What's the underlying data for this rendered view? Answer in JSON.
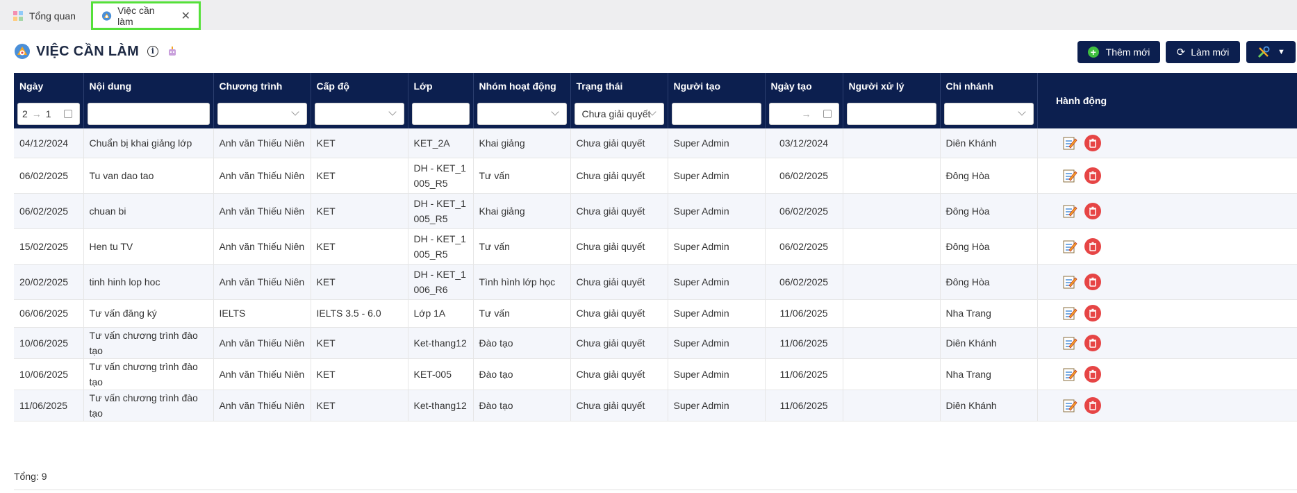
{
  "tabs": [
    {
      "label": "Tổng quan"
    },
    {
      "label": "Việc cần làm"
    }
  ],
  "page": {
    "title": "VIỆC CẦN LÀM"
  },
  "toolbar": {
    "add_label": "Thêm mới",
    "refresh_label": "Làm mới"
  },
  "columns": [
    "Ngày",
    "Nội dung",
    "Chương trình",
    "Cấp độ",
    "Lớp",
    "Nhóm hoạt động",
    "Trạng thái",
    "Người tạo",
    "Ngày tạo",
    "Người xử lý",
    "Chi nhánh",
    "Hành động"
  ],
  "filters": {
    "date_from": "2",
    "date_to": "1",
    "status": "Chưa giải quyết"
  },
  "rows": [
    {
      "date": "04/12/2024",
      "content": "Chuẩn bị khai giảng lớp",
      "program": "Anh văn Thiếu Niên",
      "level": "KET",
      "class_l1": "KET_2A",
      "class_l2": "",
      "group": "Khai giảng",
      "status": "Chưa giải quyết",
      "creator": "Super Admin",
      "created": "03/12/2024",
      "handler": "",
      "branch": "Diên Khánh"
    },
    {
      "date": "06/02/2025",
      "content": "Tu van dao tao",
      "program": "Anh văn Thiếu Niên",
      "level": "KET",
      "class_l1": "DH - KET_1",
      "class_l2": "005_R5",
      "group": "Tư vấn",
      "status": "Chưa giải quyết",
      "creator": "Super Admin",
      "created": "06/02/2025",
      "handler": "",
      "branch": "Đông Hòa"
    },
    {
      "date": "06/02/2025",
      "content": "chuan bi",
      "program": "Anh văn Thiếu Niên",
      "level": "KET",
      "class_l1": "DH - KET_1",
      "class_l2": "005_R5",
      "group": "Khai giảng",
      "status": "Chưa giải quyết",
      "creator": "Super Admin",
      "created": "06/02/2025",
      "handler": "",
      "branch": "Đông Hòa"
    },
    {
      "date": "15/02/2025",
      "content": "Hen tu TV",
      "program": "Anh văn Thiếu Niên",
      "level": "KET",
      "class_l1": "DH - KET_1",
      "class_l2": "005_R5",
      "group": "Tư vấn",
      "status": "Chưa giải quyết",
      "creator": "Super Admin",
      "created": "06/02/2025",
      "handler": "",
      "branch": "Đông Hòa"
    },
    {
      "date": "20/02/2025",
      "content": "tinh hinh lop hoc",
      "program": "Anh văn Thiếu Niên",
      "level": "KET",
      "class_l1": "DH - KET_1",
      "class_l2": "006_R6",
      "group": "Tình hình lớp học",
      "status": "Chưa giải quyết",
      "creator": "Super Admin",
      "created": "06/02/2025",
      "handler": "",
      "branch": "Đông Hòa"
    },
    {
      "date": "06/06/2025",
      "content": "Tư vấn đăng ký",
      "program": "IELTS",
      "level": "IELTS 3.5 - 6.0",
      "class_l1": "Lớp 1A",
      "class_l2": "",
      "group": "Tư vấn",
      "status": "Chưa giải quyết",
      "creator": "Super Admin",
      "created": "11/06/2025",
      "handler": "",
      "branch": "Nha Trang"
    },
    {
      "date": "10/06/2025",
      "content": "Tư vấn chương trình đào tạo",
      "program": "Anh văn Thiếu Niên",
      "level": "KET",
      "class_l1": "Ket-thang12",
      "class_l2": "",
      "group": "Đào tạo",
      "status": "Chưa giải quyết",
      "creator": "Super Admin",
      "created": "11/06/2025",
      "handler": "",
      "branch": "Diên Khánh"
    },
    {
      "date": "10/06/2025",
      "content": "Tư vấn chương trình đào tạo",
      "program": "Anh văn Thiếu Niên",
      "level": "KET",
      "class_l1": "KET-005",
      "class_l2": "",
      "group": "Đào tạo",
      "status": "Chưa giải quyết",
      "creator": "Super Admin",
      "created": "11/06/2025",
      "handler": "",
      "branch": "Nha Trang"
    },
    {
      "date": "11/06/2025",
      "content": "Tư vấn chương trình đào tạo",
      "program": "Anh văn Thiếu Niên",
      "level": "KET",
      "class_l1": "Ket-thang12",
      "class_l2": "",
      "group": "Đào tạo",
      "status": "Chưa giải quyết",
      "creator": "Super Admin",
      "created": "11/06/2025",
      "handler": "",
      "branch": "Diên Khánh"
    }
  ],
  "footer": {
    "total_label": "Tổng: 9"
  },
  "colors": {
    "header_bg": "#0c1f4f",
    "active_tab_border": "#55e03a",
    "delete": "#e64545",
    "add_icon": "#3fbf3f"
  },
  "icons": [
    "dashboard-icon",
    "todo-icon",
    "close-icon",
    "info-icon",
    "robot-icon",
    "plus-icon",
    "refresh-icon",
    "tools-icon",
    "caret-down-icon",
    "calendar-icon",
    "chevron-down-icon",
    "edit-icon",
    "trash-icon"
  ]
}
